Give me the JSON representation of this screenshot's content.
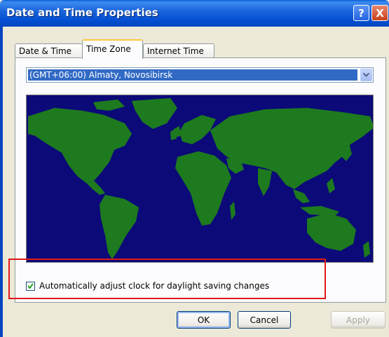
{
  "window": {
    "title": "Date and Time Properties",
    "help_label": "?",
    "close_label": "X"
  },
  "tabs": [
    {
      "label": "Date & Time",
      "active": false
    },
    {
      "label": "Time Zone",
      "active": true
    },
    {
      "label": "Internet Time",
      "active": false
    }
  ],
  "timezone": {
    "selected": "(GMT+06:00) Almaty, Novosibirsk"
  },
  "map": {
    "ocean_color": "#0b0a78",
    "land_color": "#1e7a1e"
  },
  "dst": {
    "label": "Automatically adjust clock for daylight saving changes",
    "checked": true
  },
  "buttons": {
    "ok": "OK",
    "cancel": "Cancel",
    "apply": "Apply"
  },
  "colors": {
    "title_bar": "#0450d2",
    "highlight": "#e01818",
    "selection": "#316ac5"
  }
}
